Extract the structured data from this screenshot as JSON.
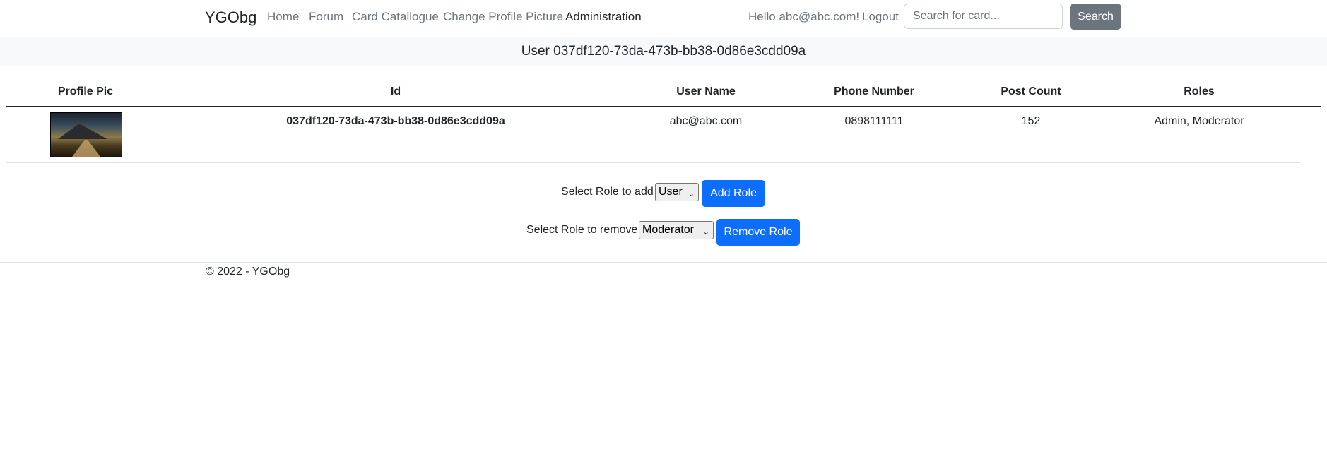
{
  "navbar": {
    "brand": "YGObg",
    "links": [
      {
        "label": "Home"
      },
      {
        "label": "Forum"
      },
      {
        "label": "Card Catallogue"
      },
      {
        "label": "Change Profile Picture"
      },
      {
        "label": "Administration"
      }
    ],
    "greeting": "Hello abc@abc.com!",
    "logout": "Logout",
    "search_placeholder": "Search for card...",
    "search_button": "Search"
  },
  "page": {
    "title": "User 037df120-73da-473b-bb38-0d86e3cdd09a"
  },
  "table": {
    "headers": [
      "Profile Pic",
      "Id",
      "User Name",
      "Phone Number",
      "Post Count",
      "Roles"
    ],
    "row": {
      "id": "037df120-73da-473b-bb38-0d86e3cdd09a",
      "user_name": "abc@abc.com",
      "phone_number": "0898111111",
      "post_count": "152",
      "roles": "Admin, Moderator"
    }
  },
  "role_management": {
    "add_label": "Select Role to add",
    "add_selected": "User",
    "add_button": "Add Role",
    "remove_label": "Select Role to remove",
    "remove_selected": "Moderator",
    "remove_button": "Remove Role"
  },
  "footer": {
    "text": "© 2022 - YGObg"
  },
  "colors": {
    "primary": "#0d6efd",
    "secondary": "#6c757d"
  }
}
